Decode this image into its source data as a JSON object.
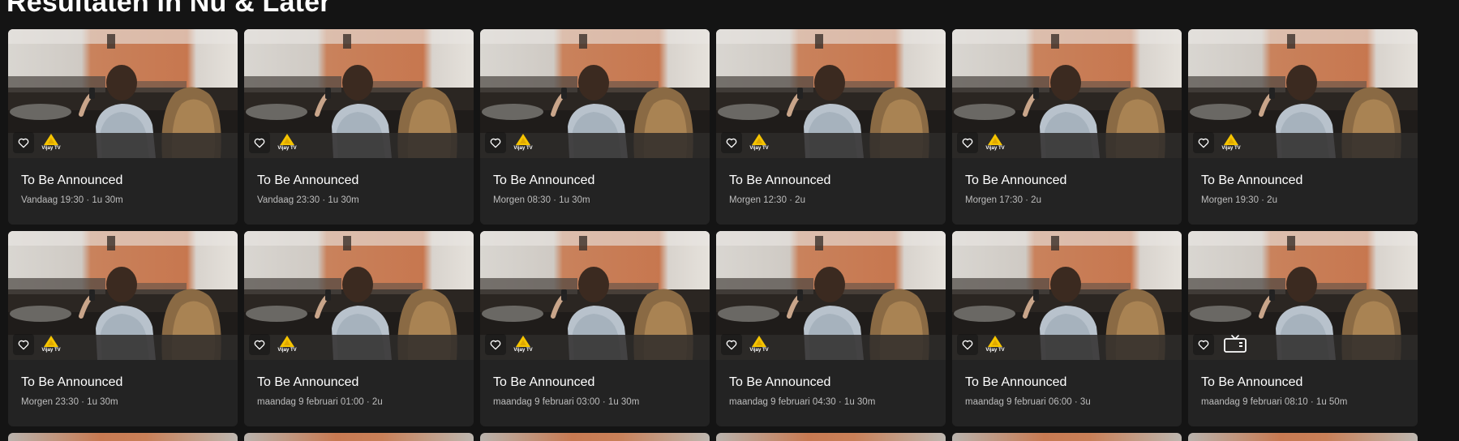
{
  "page": {
    "title": "Resultaten in Nu & Later"
  },
  "cards": [
    {
      "title": "To Be Announced",
      "meta": "Vandaag 19:30 · 1u 30m",
      "channel": "Vijay TV",
      "channel_icon": "vijay-tv-logo-icon"
    },
    {
      "title": "To Be Announced",
      "meta": "Vandaag 23:30 · 1u 30m",
      "channel": "Vijay TV",
      "channel_icon": "vijay-tv-logo-icon"
    },
    {
      "title": "To Be Announced",
      "meta": "Morgen 08:30 · 1u 30m",
      "channel": "Vijay TV",
      "channel_icon": "vijay-tv-logo-icon"
    },
    {
      "title": "To Be Announced",
      "meta": "Morgen 12:30 · 2u",
      "channel": "Vijay TV",
      "channel_icon": "vijay-tv-logo-icon"
    },
    {
      "title": "To Be Announced",
      "meta": "Morgen 17:30 · 2u",
      "channel": "Vijay TV",
      "channel_icon": "vijay-tv-logo-icon"
    },
    {
      "title": "To Be Announced",
      "meta": "Morgen 19:30 · 2u",
      "channel": "Vijay TV",
      "channel_icon": "vijay-tv-logo-icon"
    },
    {
      "title": "To Be Announced",
      "meta": "Morgen 23:30 · 1u 30m",
      "channel": "Vijay TV",
      "channel_icon": "vijay-tv-logo-icon"
    },
    {
      "title": "To Be Announced",
      "meta": "maandag 9 februari 01:00 · 2u",
      "channel": "Vijay TV",
      "channel_icon": "vijay-tv-logo-icon"
    },
    {
      "title": "To Be Announced",
      "meta": "maandag 9 februari 03:00 · 1u 30m",
      "channel": "Vijay TV",
      "channel_icon": "vijay-tv-logo-icon"
    },
    {
      "title": "To Be Announced",
      "meta": "maandag 9 februari 04:30 · 1u 30m",
      "channel": "Vijay TV",
      "channel_icon": "vijay-tv-logo-icon"
    },
    {
      "title": "To Be Announced",
      "meta": "maandag 9 februari 06:00 · 3u",
      "channel": "Vijay TV",
      "channel_icon": "vijay-tv-logo-icon"
    },
    {
      "title": "To Be Announced",
      "meta": "maandag 9 februari 08:10 · 1u 50m",
      "channel": "",
      "channel_icon": "tv-icon"
    }
  ],
  "icons": {
    "favorite": "heart-outline-icon",
    "thumbnail": "couple-watching-tv-image"
  },
  "colors": {
    "background": "#141414",
    "card": "#232323",
    "title_text": "#ffffff",
    "meta_text": "#bdbdbd",
    "vijay_logo": "#f5c400"
  }
}
